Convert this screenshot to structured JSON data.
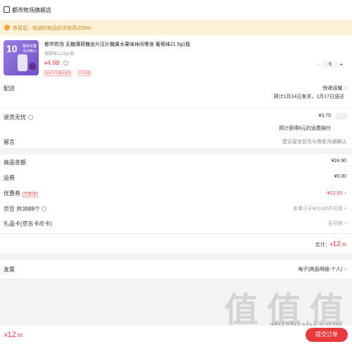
{
  "store": {
    "name": "都市牧场旗舰店"
  },
  "notice": {
    "text": "恭喜您，挑选的商品好评度高达99%"
  },
  "product": {
    "title": "都市牧场 无糖薄荷糖含片压片糖果水果味休闲零食 葡萄味21.5g1瓶",
    "spec": "葡萄味21.5g1瓶",
    "price_symbol": "¥",
    "price": "4.98",
    "tag1": "支持7天无理由退货",
    "tag2": "7天价保",
    "qty": "5",
    "qty_minus": "-",
    "qty_plus": "+",
    "thumb_badge": "10",
    "thumb_line1": "葡萄无糖",
    "thumb_line2": "清凉爽口"
  },
  "delivery": {
    "label": "配送",
    "method": "快递运输",
    "schedule": "预计1月14日发货，1月17日送达"
  },
  "return_policy": {
    "label": "退货无忧",
    "price": "¥3.70",
    "note": "预计获得8元的运费赔付"
  },
  "message": {
    "label": "留言",
    "placeholder": "建议留言前先与商家沟通确认"
  },
  "summary": {
    "goods_amount_label": "商品金额",
    "goods_amount": "¥24.90",
    "shipping_label": "运费",
    "shipping": "¥0.00",
    "coupon_label": "优惠券",
    "coupon_tag": "已选1张",
    "coupon_value": "-¥12.00",
    "jingdou_label": "京豆 共3988个",
    "jingdou_note": "本单小于¥20.00不可用",
    "giftcard_label": "礼品卡(京东卡/E卡)",
    "giftcard_value": "无可用",
    "total_label": "合计：",
    "total_symbol": "¥",
    "total_int": "12",
    "total_dec": ".90"
  },
  "invoice": {
    "label": "发票",
    "value": "电子(商品明细-个人)"
  },
  "footer": {
    "price_symbol": "¥",
    "price_int": "12",
    "price_dec": ".90",
    "submit_label": "提交订单",
    "watermark": "值 值 值",
    "watermark_url": "zhizhizhi.com"
  },
  "colors": {
    "accent": "#e93b3d",
    "notice_bg": "#fdf2d6",
    "notice_text": "#c88a2e",
    "thumb_bg": "#7b5fd0"
  }
}
